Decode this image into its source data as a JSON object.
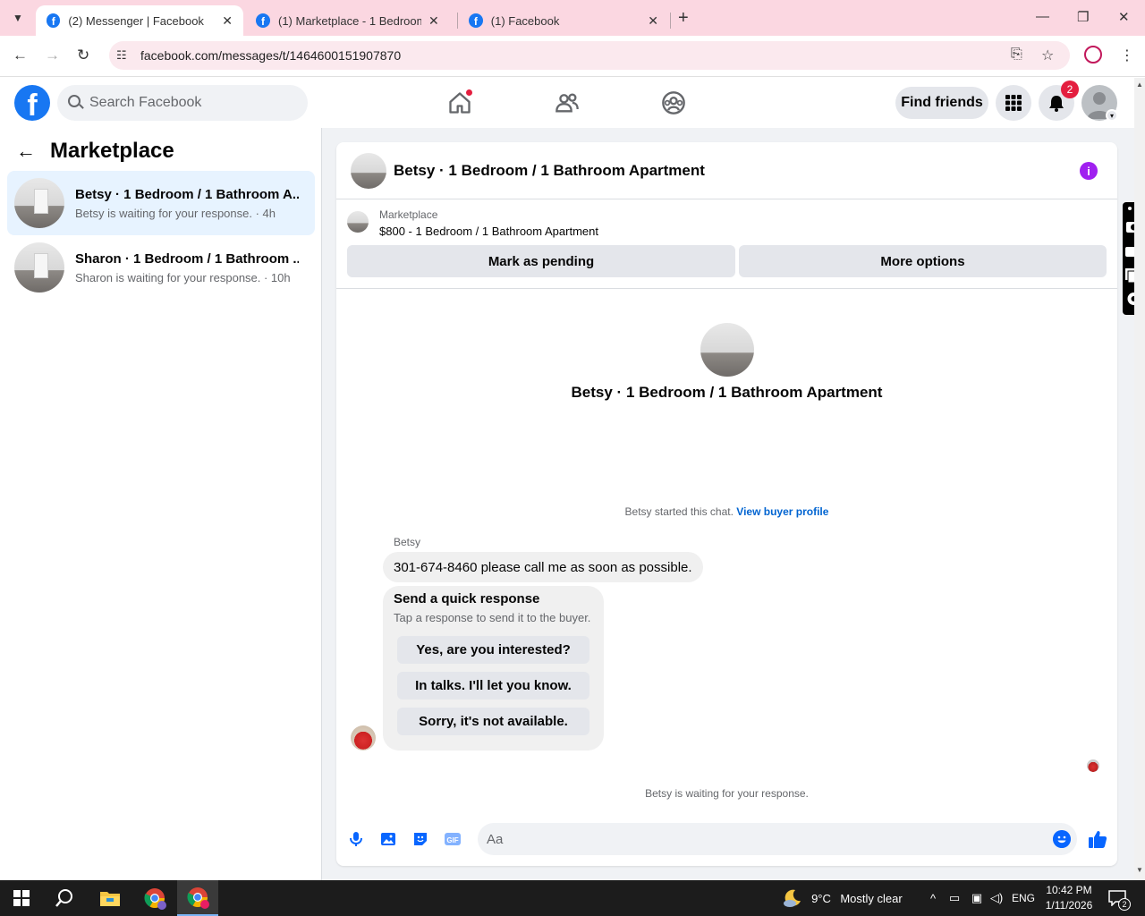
{
  "browser": {
    "tabs": [
      {
        "title": "(2) Messenger | Facebook",
        "active": true
      },
      {
        "title": "(1) Marketplace - 1 Bedroom /",
        "active": false
      },
      {
        "title": "(1) Facebook",
        "active": false
      }
    ],
    "url": "facebook.com/messages/t/1464600151907870"
  },
  "fb_nav": {
    "search_placeholder": "Search Facebook",
    "find_friends_label": "Find friends",
    "notification_count": "2"
  },
  "left_panel": {
    "title": "Marketplace",
    "conversations": [
      {
        "title": "Betsy · 1 Bedroom / 1 Bathroom A...",
        "subtitle": "Betsy is waiting for your response. · 4h",
        "active": true
      },
      {
        "title": "Sharon · 1 Bedroom / 1 Bathroom ...",
        "subtitle": "Sharon is waiting for your response. · 10h",
        "active": false
      }
    ]
  },
  "chat": {
    "header_title": "Betsy · 1 Bedroom / 1 Bathroom Apartment",
    "listing_category": "Marketplace",
    "listing_summary": "$800 - 1 Bedroom / 1 Bathroom Apartment",
    "mark_pending_label": "Mark as pending",
    "more_options_label": "More options",
    "profile_name": "Betsy · 1 Bedroom / 1 Bathroom Apartment",
    "started_text": "Betsy started this chat.",
    "view_profile_link": "View buyer profile",
    "sender_name": "Betsy",
    "message": "301-674-8460 please call me as soon as possible.",
    "quick_response": {
      "title": "Send a quick response",
      "subtitle": "Tap a response to send it to the buyer.",
      "options": [
        "Yes, are you interested?",
        "In talks. I'll let you know.",
        "Sorry, it's not available."
      ]
    },
    "waiting_text": "Betsy is waiting for your response.",
    "composer_placeholder": "Aa",
    "gif_label": "GIF"
  },
  "taskbar": {
    "weather_temp": "9°C",
    "weather_text": "Mostly clear",
    "language": "ENG",
    "time": "10:42 PM",
    "date": "1/11/2026",
    "notification_count": "2"
  },
  "colors": {
    "fb_blue": "#1877f2",
    "messenger_blue": "#0866ff",
    "badge_red": "#e41e3f",
    "info_purple": "#a020f0",
    "tabstrip_pink": "#fbd7e1"
  }
}
